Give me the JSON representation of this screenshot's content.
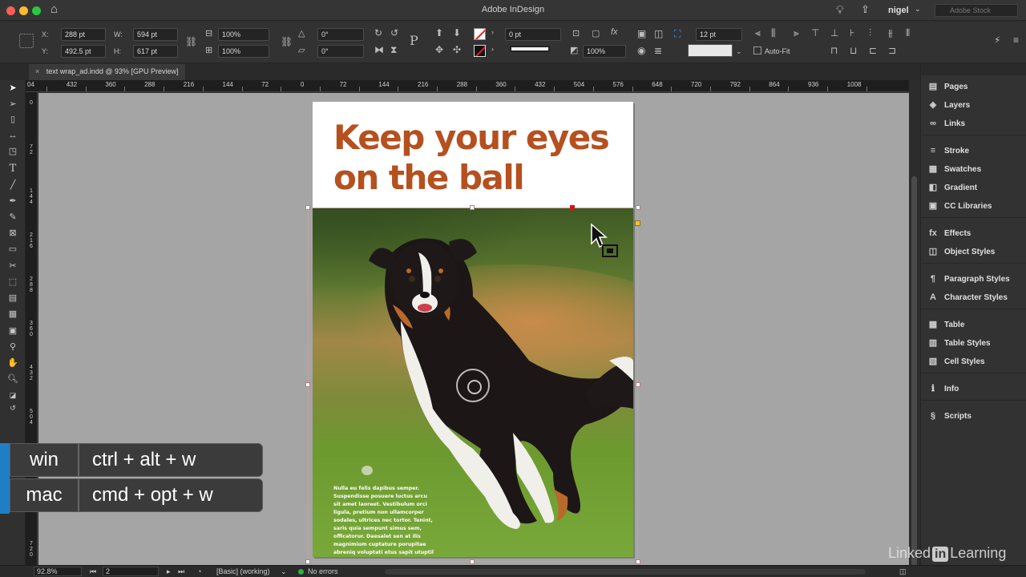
{
  "app": {
    "title": "Adobe InDesign",
    "user": "nigel",
    "stock_placeholder": "Adobe Stock"
  },
  "control_panel": {
    "x_label": "X:",
    "x_value": "288 pt",
    "y_label": "Y:",
    "y_value": "492.5 pt",
    "w_label": "W:",
    "w_value": "594 pt",
    "h_label": "H:",
    "h_value": "617 pt",
    "scale_x": "100%",
    "scale_y": "100%",
    "rotate": "0°",
    "shear": "0°",
    "stroke_weight": "0 pt",
    "opacity": "100%",
    "wrap_offset": "12 pt",
    "auto_fit_label": "Auto-Fit"
  },
  "document_tab": {
    "close": "×",
    "title": "text wrap_ad.indd @ 93% [GPU Preview]"
  },
  "ruler_top": [
    "04",
    "432",
    "360",
    "288",
    "216",
    "144",
    "72",
    "0",
    "72",
    "144",
    "216",
    "288",
    "360",
    "432",
    "504",
    "576",
    "648",
    "720",
    "792",
    "864",
    "936",
    "1008"
  ],
  "ruler_left": [
    "0",
    "7\n2",
    "1\n4\n4",
    "2\n1\n6",
    "2\n8\n8",
    "3\n6\n0",
    "4\n3\n2",
    "5\n0\n4",
    "5\n7\n6",
    "6\n4\n8",
    "7\n2\n0",
    "7"
  ],
  "page": {
    "headline_line1": "Keep your eyes",
    "headline_line2": "on the ball",
    "body_text": "Nulla eu felis dapibus semper. Suspendisse posuere luctus arcu sit amet laoreet. Vestibulum orci ligula, pretium non ullamcorper sodales, ultrices nec tortor. Tenint, saris quia sempunt simus sem, officatorur. Daesalet sen at ilis magnimium cuptature porupitae abreniq voluptati etus sapit utuptil isequis sitatem.",
    "headline_color": "#b5501f"
  },
  "panels": [
    {
      "label": "Pages",
      "icon": "pages-icon",
      "glyph": "▤"
    },
    {
      "label": "Layers",
      "icon": "layers-icon",
      "glyph": "◈"
    },
    {
      "label": "Links",
      "icon": "links-icon",
      "glyph": "∞"
    },
    {
      "label": "Stroke",
      "icon": "stroke-icon",
      "glyph": "≡"
    },
    {
      "label": "Swatches",
      "icon": "swatches-icon",
      "glyph": "▦"
    },
    {
      "label": "Gradient",
      "icon": "gradient-icon",
      "glyph": "◧"
    },
    {
      "label": "CC Libraries",
      "icon": "cc-libraries-icon",
      "glyph": "▣"
    },
    {
      "label": "Effects",
      "icon": "effects-icon",
      "glyph": "fx"
    },
    {
      "label": "Object Styles",
      "icon": "object-styles-icon",
      "glyph": "◫"
    },
    {
      "label": "Paragraph Styles",
      "icon": "paragraph-styles-icon",
      "glyph": "¶"
    },
    {
      "label": "Character Styles",
      "icon": "character-styles-icon",
      "glyph": "A"
    },
    {
      "label": "Table",
      "icon": "table-icon",
      "glyph": "▦"
    },
    {
      "label": "Table Styles",
      "icon": "table-styles-icon",
      "glyph": "▥"
    },
    {
      "label": "Cell Styles",
      "icon": "cell-styles-icon",
      "glyph": "▧"
    },
    {
      "label": "Info",
      "icon": "info-icon",
      "glyph": "ℹ"
    },
    {
      "label": "Scripts",
      "icon": "scripts-icon",
      "glyph": "§"
    }
  ],
  "shortcut": {
    "win_label": "win",
    "win_keys": "ctrl + alt + w",
    "mac_label": "mac",
    "mac_keys": "cmd + opt + w",
    "accent_color": "#1e7fc7"
  },
  "status": {
    "zoom": "92.8%",
    "page": "2",
    "preflight_profile": "[Basic] (working)",
    "errors": "No errors",
    "ok_color": "#2fb04a"
  },
  "watermark": {
    "part1": "Linked",
    "part2": "in",
    "part3": "Learning"
  }
}
